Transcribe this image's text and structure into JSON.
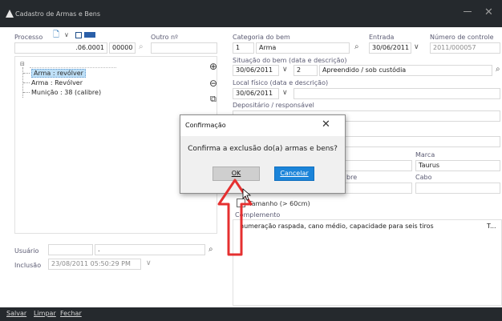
{
  "window": {
    "title": "Cadastro de Armas e Bens",
    "minimize_icon": "minimize-icon",
    "close_icon": "close-icon"
  },
  "processo": {
    "label": "Processo",
    "part1": ".06.0001",
    "part2": "00000"
  },
  "outro": {
    "label": "Outro nº",
    "value": ""
  },
  "categoria": {
    "label": "Categoria do bem",
    "code": "1",
    "name": "Arma"
  },
  "entrada": {
    "label": "Entrada",
    "value": "30/06/2011"
  },
  "numero_controle": {
    "label": "Número de controle",
    "value": "2011/000057"
  },
  "tree": {
    "root_expander": "⊟",
    "items": [
      "Arma : revólver",
      "Arma : Revólver",
      "Munição : 38 (calibre)"
    ]
  },
  "situacao": {
    "label": "Situação do bem (data e descrição)",
    "date": "30/06/2011",
    "code": "2",
    "desc": "Apreendido / sob custódia"
  },
  "local": {
    "label": "Local físico (data e descrição)",
    "date": "30/06/2011"
  },
  "depositario": {
    "label": "Depositário / responsável"
  },
  "marca": {
    "label": "Marca",
    "value": "Taurus"
  },
  "bre_label": "bre",
  "cabo": {
    "label": "Cabo",
    "value": ""
  },
  "tamanho": {
    "label": "Tamanho (> 60cm)"
  },
  "complemento": {
    "label": "Complemento",
    "value": "numeração raspada, cano médio, capacidade para seis tiros",
    "ellipsis": "T..."
  },
  "usuario": {
    "label": "Usuário",
    "value": "."
  },
  "inclusao": {
    "label": "Inclusão",
    "value": "23/08/2011 05:50:29 PM"
  },
  "bottom": {
    "save": "Salvar",
    "clear": "Limpar",
    "close": "Fechar"
  },
  "dialog": {
    "title": "Confirmação",
    "message": "Confirma a exclusão do(a) armas e bens?",
    "ok": "OK",
    "cancel": "Cancelar"
  },
  "colors": {
    "accent": "#1b84d9",
    "bar": "#25292d",
    "annotation_arrow": "#e53030"
  }
}
